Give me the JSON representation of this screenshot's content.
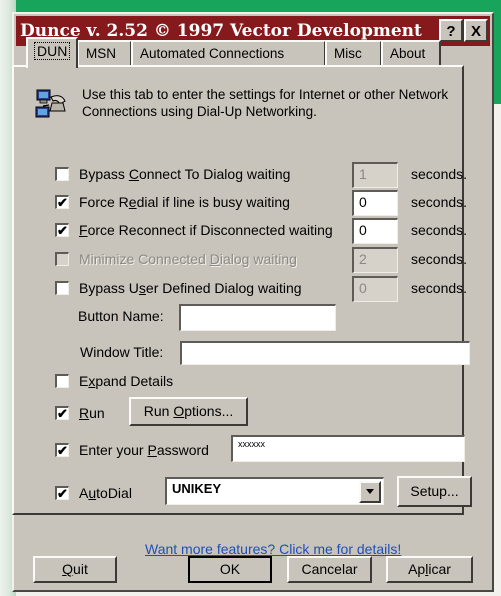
{
  "window": {
    "title": "Dunce v. 2.52 © 1997 Vector Development",
    "help_label": "?",
    "close_label": "X"
  },
  "tabs": [
    {
      "label": "DUN"
    },
    {
      "label": "MSN"
    },
    {
      "label": "Automated Connections"
    },
    {
      "label": "Misc"
    },
    {
      "label": "About"
    }
  ],
  "info": {
    "icon": "dial-up-networking-icon",
    "text": "Use this tab to enter the settings for Internet or other Network Connections using Dial-Up Networking."
  },
  "options": [
    {
      "pre": "Bypass ",
      "key": "C",
      "post": "onnect To Dialog waiting",
      "checked": false,
      "enabled": true,
      "value": "1",
      "value_enabled": false,
      "unit": "seconds."
    },
    {
      "pre": "Force R",
      "key": "e",
      "post": "dial if line is busy waiting",
      "checked": true,
      "enabled": true,
      "value": "0",
      "value_enabled": true,
      "unit": "seconds."
    },
    {
      "pre": "",
      "key": "F",
      "post": "orce Reconnect if Disconnected waiting",
      "checked": true,
      "enabled": true,
      "value": "0",
      "value_enabled": true,
      "unit": "seconds."
    },
    {
      "pre": "Minimize Connected ",
      "key": "D",
      "post": "ialog waiting",
      "checked": false,
      "enabled": false,
      "value": "2",
      "value_enabled": false,
      "unit": "seconds."
    },
    {
      "pre": "Bypass U",
      "key": "s",
      "post": "er Defined Dialog waiting",
      "checked": false,
      "enabled": true,
      "value": "0",
      "value_enabled": false,
      "unit": "seconds."
    }
  ],
  "button_name": {
    "label": "Button Name:",
    "value": ""
  },
  "window_title": {
    "label": "Window Title:",
    "value": ""
  },
  "expand_details": {
    "pre": "E",
    "key": "x",
    "post": "pand Details",
    "checked": false
  },
  "run": {
    "pre": "",
    "key": "R",
    "post": "un",
    "checked": true,
    "options_pre": "Run ",
    "options_key": "O",
    "options_post": "ptions..."
  },
  "password": {
    "pre": "Enter your ",
    "key": "P",
    "post": "assword",
    "checked": true,
    "value": "xxxxxx"
  },
  "autodial": {
    "pre": "A",
    "key": "u",
    "post": "toDial",
    "checked": true,
    "selected": "UNIKEY",
    "setup_label": "Setup..."
  },
  "more_link": "Want more features? Click me for details!",
  "footer": {
    "quit_key": "Q",
    "quit_post": "uit",
    "ok_label": "OK",
    "cancel_label": "Cancelar",
    "apply_pre": "Ap",
    "apply_key": "l",
    "apply_post": "icar"
  }
}
